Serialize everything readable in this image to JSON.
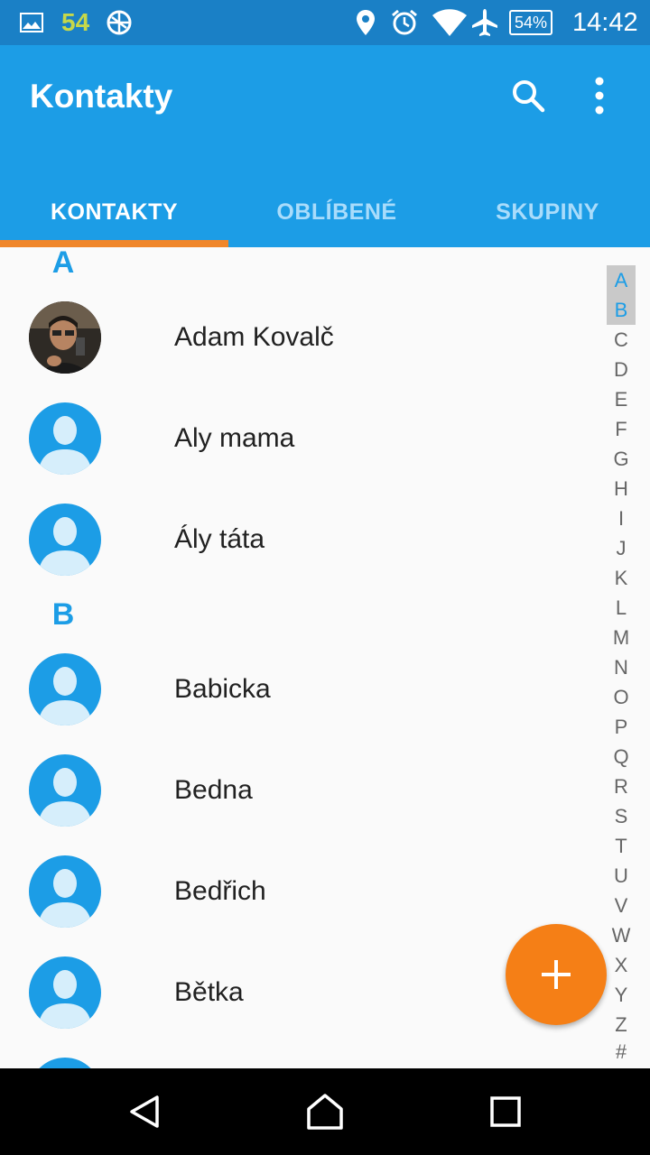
{
  "status_bar": {
    "notification_count": "54",
    "battery": "54%",
    "time": "14:42",
    "icons": [
      "image-icon",
      "no-sync-icon",
      "location-icon",
      "alarm-icon",
      "wifi-icon",
      "airplane-icon"
    ]
  },
  "app_bar": {
    "title": "Kontakty",
    "actions": [
      "search-icon",
      "more-vert-icon"
    ],
    "tabs": [
      {
        "label": "KONTAKTY",
        "active": true
      },
      {
        "label": "OBLÍBENÉ",
        "active": false
      },
      {
        "label": "SKUPINY",
        "active": false
      }
    ],
    "color": "#1c9de6",
    "indicator_color": "#f0862a"
  },
  "sections": [
    {
      "letter": "A",
      "contacts": [
        {
          "name": "Adam Kovalč",
          "avatar": "photo"
        },
        {
          "name": "Aly mama",
          "avatar": "default"
        },
        {
          "name": "Ály táta",
          "avatar": "default"
        }
      ]
    },
    {
      "letter": "B",
      "contacts": [
        {
          "name": "Babicka",
          "avatar": "default"
        },
        {
          "name": "Bedna",
          "avatar": "default"
        },
        {
          "name": "Bedřich",
          "avatar": "default"
        },
        {
          "name": "Bětka",
          "avatar": "default"
        }
      ]
    }
  ],
  "alphabet_index": {
    "letters": [
      "A",
      "B",
      "C",
      "D",
      "E",
      "F",
      "G",
      "H",
      "I",
      "J",
      "K",
      "L",
      "M",
      "N",
      "O",
      "P",
      "Q",
      "R",
      "S",
      "T",
      "U",
      "V",
      "W",
      "X",
      "Y",
      "Z",
      "#"
    ],
    "highlighted": [
      "A",
      "B"
    ]
  },
  "fab": {
    "icon": "plus-icon",
    "color": "#f57f16"
  },
  "nav_bar": {
    "buttons": [
      "back-icon",
      "home-icon",
      "recents-icon"
    ]
  }
}
